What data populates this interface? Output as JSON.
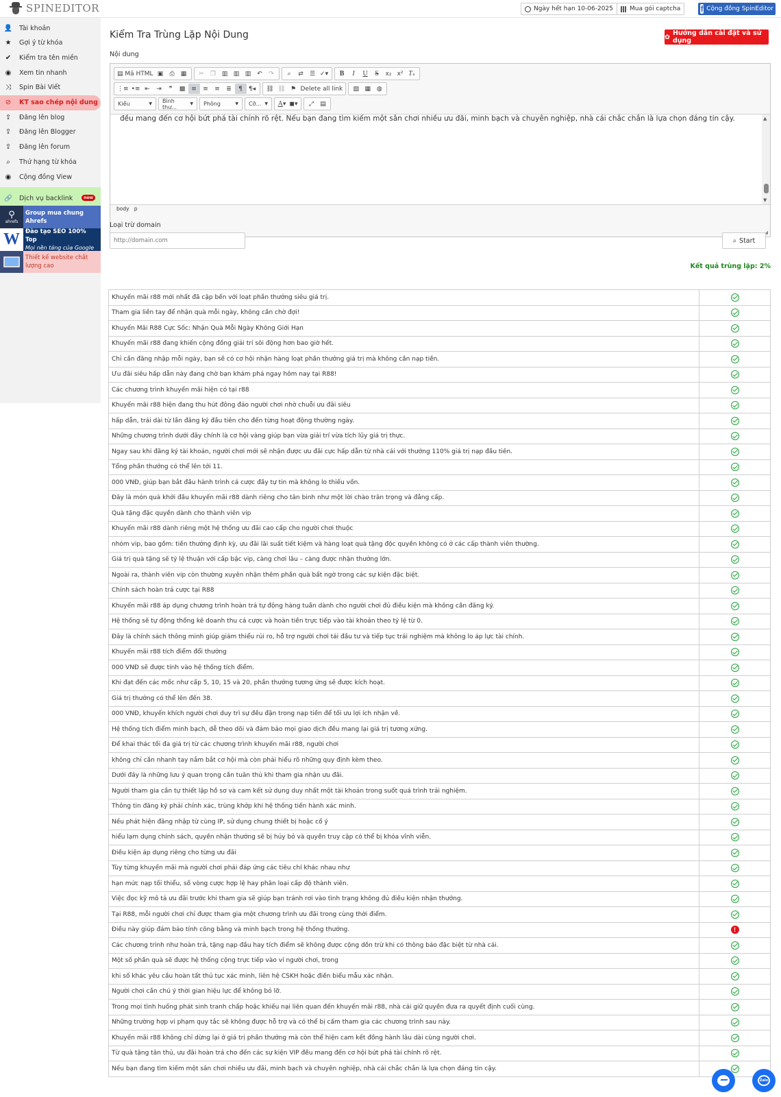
{
  "app": {
    "logo_text": "SPINEDITOR"
  },
  "topbar": {
    "expiry_label": "Ngày hết hạn 10-06-2025",
    "captcha_label": "Mua gói captcha",
    "community_label": "Cộng đồng SpinEditor"
  },
  "sidebar": {
    "items": [
      {
        "label": "Tài khoản",
        "icon": "user-icon",
        "glyph": "👤"
      },
      {
        "label": "Gợi ý từ khóa",
        "icon": "star-icon",
        "glyph": "★"
      },
      {
        "label": "Kiểm tra tên miền",
        "icon": "check-icon",
        "glyph": "✔"
      },
      {
        "label": "Xem tin nhanh",
        "icon": "eye-icon",
        "glyph": "◉"
      },
      {
        "label": "Spin Bài Viết",
        "icon": "shuffle-icon",
        "glyph": "⤨"
      },
      {
        "label": "KT sao chép nội dung",
        "icon": "copy-check-icon",
        "glyph": "⊘",
        "active": true
      },
      {
        "label": "Đăng lên blog",
        "icon": "upload-icon",
        "glyph": "⇪"
      },
      {
        "label": "Đăng lên Blogger",
        "icon": "upload-icon",
        "glyph": "⇪"
      },
      {
        "label": "Đăng lên forum",
        "icon": "upload-icon",
        "glyph": "⇪"
      },
      {
        "label": "Thứ hạng từ khóa",
        "icon": "search-icon",
        "glyph": "⌕"
      },
      {
        "label": "Cộng đồng View",
        "icon": "eye-icon",
        "glyph": "◉"
      }
    ],
    "backlink_label": "Dịch vụ backlink",
    "new_badge": "new",
    "ads": [
      {
        "line1": "Group mua chung Ahrefs",
        "line2": "",
        "icon_text": "ahrefs"
      },
      {
        "line1": "Đào tạo SEO 100% Top",
        "line2": "Mọi nền tảng của Google",
        "icon_text": "W"
      },
      {
        "line1": "Thiết kế website chất",
        "line2": "lượng cao",
        "icon_text": ""
      }
    ]
  },
  "main": {
    "title": "Kiểm Tra Trùng Lặp Nội Dung",
    "help_button": "Hướng dẫn cài đặt và sử dụng",
    "content_label": "Nội dung",
    "editor": {
      "source_label": "Mã HTML",
      "delete_links_label": "Delete all link",
      "format_dropdown": "Kiểu",
      "style_dropdown": "Bình thư...",
      "font_dropdown": "Phông",
      "size_dropdown": "Cỡ...",
      "text": "đều mang đến cơ hội bứt phá tài chính rõ rệt. Nếu bạn đang tìm kiếm một sân chơi nhiều ưu đãi, minh bạch và chuyên nghiệp, nhà cái chắc chắn là lựa chọn đáng tin cậy.",
      "path_body": "body",
      "path_p": "p"
    },
    "exclude_label": "Loại trừ domain",
    "domain_placeholder": "http://domain.com",
    "start_button": "Start",
    "result_text": "Kết quả trùng lặp: 2%"
  },
  "results": [
    {
      "text": "Khuyến mãi r88 mới nhất đã cập bến với loạt phần thưởng siêu giá trị.",
      "status": "ok"
    },
    {
      "text": "Tham gia liền tay để nhận quà mỗi ngày, không cần chờ đợi!",
      "status": "ok"
    },
    {
      "text": "Khuyến Mãi R88 Cực Sốc: Nhận Quà Mỗi Ngày Không Giới Hạn",
      "status": "ok"
    },
    {
      "text": "Khuyến mãi r88 đang khiến cộng đồng giải trí sôi động hơn bao giờ hết.",
      "status": "ok"
    },
    {
      "text": "Chỉ cần đăng nhập mỗi ngày, bạn sẽ có cơ hội nhận hàng loạt phần thưởng giá trị mà không cần nạp tiền.",
      "status": "ok"
    },
    {
      "text": "Ưu đãi siêu hấp dẫn này đang chờ bạn khám phá ngay hôm nay tại R88!",
      "status": "ok"
    },
    {
      "text": "Các chương trình khuyến mãi hiện có tại r88",
      "status": "ok"
    },
    {
      "text": "Khuyến mãi r88 hiện đang thu hút đông đảo người chơi nhờ chuỗi ưu đãi siêu",
      "status": "ok"
    },
    {
      "text": "hấp dẫn, trải dài từ lần đăng ký đầu tiên cho đến từng hoạt động thường ngày.",
      "status": "ok"
    },
    {
      "text": "Những chương trình dưới đây chính là cơ hội vàng giúp bạn vừa giải trí vừa tích lũy giá trị thực.",
      "status": "ok"
    },
    {
      "text": "Ngay sau khi đăng ký tài khoản, người chơi mới sẽ nhận được ưu đãi cực hấp dẫn từ nhà cái với thưởng 110% giá trị nạp đầu tiên.",
      "status": "ok"
    },
    {
      "text": "Tổng phần thưởng có thể lên tới 11.",
      "status": "ok"
    },
    {
      "text": "000 VNĐ, giúp bạn bắt đầu hành trình cá cược đầy tự tin mà không lo thiếu vốn.",
      "status": "ok"
    },
    {
      "text": "Đây là món quà khởi đầu khuyến mãi r88 dành riêng cho tân binh như một lời chào trân trọng và đẳng cấp.",
      "status": "ok"
    },
    {
      "text": "Quà tặng đặc quyền dành cho thành viên vip",
      "status": "ok"
    },
    {
      "text": "Khuyến mãi r88 dành riêng một hệ thống ưu đãi cao cấp cho người chơi thuộc",
      "status": "ok"
    },
    {
      "text": "nhóm vip, bao gồm: tiền thưởng định kỳ, ưu đãi lãi suất tiết kiệm và hàng loạt quà tặng độc quyền không có ở các cấp thành viên thường.",
      "status": "ok"
    },
    {
      "text": "Giá trị quà tặng sẽ tỷ lệ thuận với cấp bậc vip, càng chơi lâu – càng được nhận thưởng lớn.",
      "status": "ok"
    },
    {
      "text": "Ngoài ra, thành viên vip còn thường xuyên nhận thêm phần quà bất ngờ trong các sự kiện đặc biệt.",
      "status": "ok"
    },
    {
      "text": "Chính sách hoàn trả cược tại R88",
      "status": "ok"
    },
    {
      "text": "Khuyến mãi r88 áp dụng chương trình hoàn trả tự động hàng tuần dành cho người chơi đủ điều kiện mà không cần đăng ký.",
      "status": "ok"
    },
    {
      "text": "Hệ thống sẽ tự động thống kê doanh thu cá cược và hoàn tiền trực tiếp vào tài khoản theo tỷ lệ từ 0.",
      "status": "ok"
    },
    {
      "text": "Đây là chính sách thông minh giúp giảm thiểu rủi ro, hỗ trợ người chơi tái đầu tư và tiếp tục trải nghiệm mà không lo áp lực tài chính.",
      "status": "ok"
    },
    {
      "text": "Khuyến mãi r88 tích điểm đổi thưởng",
      "status": "ok"
    },
    {
      "text": "000 VNĐ sẽ được tính vào hệ thống tích điểm.",
      "status": "ok"
    },
    {
      "text": "Khi đạt đến các mốc như cấp 5, 10, 15 và 20, phần thưởng tương ứng sẽ được kích hoạt.",
      "status": "ok"
    },
    {
      "text": "Giá trị thưởng có thể lên đến 38.",
      "status": "ok"
    },
    {
      "text": "000 VNĐ, khuyến khích người chơi duy trì sự đều đặn trong nạp tiền để tối ưu lợi ích nhận về.",
      "status": "ok"
    },
    {
      "text": "Hệ thống tích điểm minh bạch, dễ theo dõi và đảm bảo mọi giao dịch đều mang lại giá trị tương xứng.",
      "status": "ok"
    },
    {
      "text": "Để khai thác tối đa giá trị từ các chương trình khuyến mãi r88, người chơi",
      "status": "ok"
    },
    {
      "text": "không chỉ cần nhanh tay nắm bắt cơ hội mà còn phải hiểu rõ những quy định kèm theo.",
      "status": "ok"
    },
    {
      "text": "Dưới đây là những lưu ý quan trọng cần tuân thủ khi tham gia nhận ưu đãi.",
      "status": "ok"
    },
    {
      "text": "Người tham gia cần tự thiết lập hồ sơ và cam kết sử dụng duy nhất một tài khoản trong suốt quá trình trải nghiệm.",
      "status": "ok"
    },
    {
      "text": "Thông tin đăng ký phải chính xác, trùng khớp khi hệ thống tiến hành xác minh.",
      "status": "ok"
    },
    {
      "text": "Nếu phát hiện đăng nhập từ cùng IP, sử dụng chung thiết bị hoặc cố ý",
      "status": "ok"
    },
    {
      "text": "hiểu lạm dụng chính sách, quyền nhận thưởng sẽ bị hủy bỏ và quyền truy cập có thể bị khóa vĩnh viễn.",
      "status": "ok"
    },
    {
      "text": "Điều kiện áp dụng riêng cho từng ưu đãi",
      "status": "ok"
    },
    {
      "text": "Tùy từng khuyến mãi mà người chơi phải đáp ứng các tiêu chí khác nhau như",
      "status": "ok"
    },
    {
      "text": "hạn mức nạp tối thiểu, số vòng cược hợp lệ hay phân loại cấp độ thành viên.",
      "status": "ok"
    },
    {
      "text": "Việc đọc kỹ mô tả ưu đãi trước khi tham gia sẽ giúp bạn tránh rơi vào tình trạng không đủ điều kiện nhận thưởng.",
      "status": "ok"
    },
    {
      "text": "Tại R88, mỗi người chơi chỉ được tham gia một chương trình ưu đãi trong cùng thời điểm.",
      "status": "ok"
    },
    {
      "text": "Điều này giúp đảm bảo tính công bằng và minh bạch trong hệ thống thưởng.",
      "status": "warn"
    },
    {
      "text": "Các chương trình như hoàn trả, tặng nạp đầu hay tích điểm sẽ không được cộng dồn trừ khi có thông báo đặc biệt từ nhà cái.",
      "status": "ok"
    },
    {
      "text": "Một số phần quà sẽ được hệ thống cộng trực tiếp vào ví người chơi, trong",
      "status": "ok"
    },
    {
      "text": "khi số khác yêu cầu hoàn tất thủ tục xác minh, liên hệ CSKH hoặc điền biểu mẫu xác nhận.",
      "status": "ok"
    },
    {
      "text": "Người chơi cần chú ý thời gian hiệu lực để không bỏ lỡ.",
      "status": "ok"
    },
    {
      "text": "Trong mọi tình huống phát sinh tranh chấp hoặc khiếu nại liên quan đến khuyến mãi r88, nhà cái giữ quyền đưa ra quyết định cuối cùng.",
      "status": "ok"
    },
    {
      "text": "Những trường hợp vi phạm quy tắc sẽ không được hỗ trợ và có thể bị cấm tham gia các chương trình sau này.",
      "status": "ok"
    },
    {
      "text": "Khuyến mãi r88 không chỉ dừng lại ở giá trị phần thưởng mà còn thể hiện cam kết đồng hành lâu dài cùng người chơi.",
      "status": "ok"
    },
    {
      "text": "Từ quà tặng tân thủ, ưu đãi hoàn trả cho đến các sự kiện VIP đều mang đến cơ hội bứt phá tài chính rõ rệt.",
      "status": "ok"
    },
    {
      "text": "Nếu bạn đang tìm kiếm một sân chơi nhiều ưu đãi, minh bạch và chuyên nghiệp, nhà cái chắc chắn là lựa chọn đáng tin cậy.",
      "status": "ok"
    }
  ],
  "colors": {
    "accent_red": "#e8191c",
    "ok_green": "#21a33a",
    "result_green": "#20871f",
    "facebook_blue": "#2d64bc",
    "chat_blue": "#1a6ff0"
  }
}
